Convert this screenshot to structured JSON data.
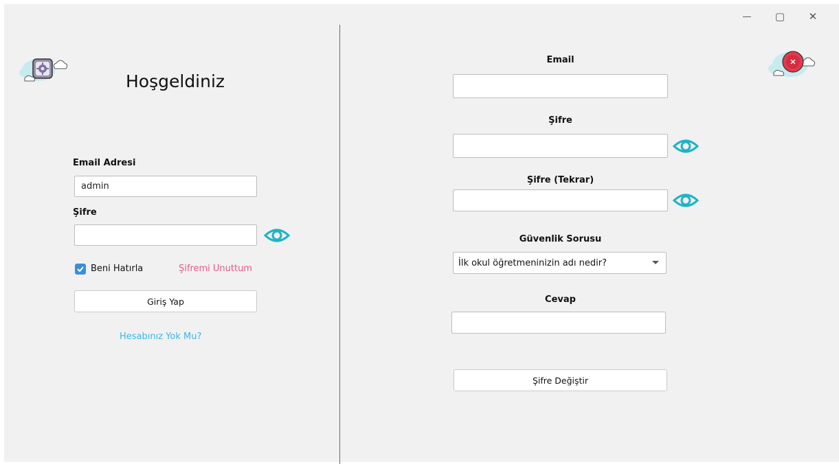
{
  "window_controls": {
    "minimize": "—",
    "maximize": "▢",
    "close": "✕"
  },
  "login": {
    "title": "Hoşgeldiniz",
    "email_label": "Email Adresi",
    "email_value": "admin",
    "password_label": "Şifre",
    "password_value": "",
    "remember_label": "Beni Hatırla",
    "remember_checked": true,
    "forgot_link": "Şifremi Unuttum",
    "login_button": "Giriş Yap",
    "signup_link": "Hesabınız Yok Mu?"
  },
  "reset": {
    "email_label": "Email",
    "password_label": "Şifre",
    "password_repeat_label": "Şifre (Tekrar)",
    "security_question_label": "Güvenlik Sorusu",
    "security_question_selected": "İlk okul öğretmeninizin adı nedir?",
    "answer_label": "Cevap",
    "change_button": "Şifre Değiştir"
  },
  "colors": {
    "eye": "#1fb3c6",
    "forgot_link": "#e8588a",
    "signup_link": "#3ab7e4",
    "checkbox": "#3a8fd9",
    "close_badge": "#e23b4e"
  },
  "icons": [
    "settings-icon",
    "eye-icon",
    "close-icon"
  ]
}
